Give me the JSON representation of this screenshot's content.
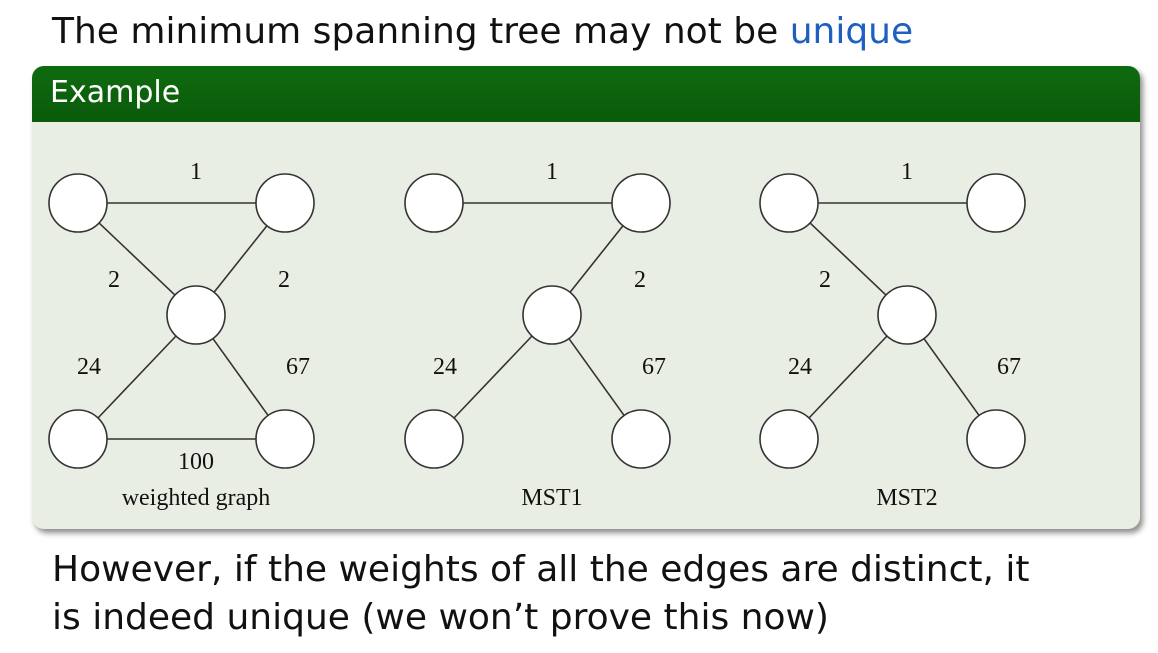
{
  "heading": {
    "text": "The minimum spanning tree may not be ",
    "emphasis": "unique"
  },
  "block": {
    "title": "Example"
  },
  "graphs": [
    {
      "caption": "weighted graph",
      "edges": [
        {
          "from": "top-left",
          "to": "top-right",
          "weight": "1"
        },
        {
          "from": "top-left",
          "to": "center",
          "weight": "2"
        },
        {
          "from": "top-right",
          "to": "center",
          "weight": "2"
        },
        {
          "from": "center",
          "to": "bottom-left",
          "weight": "24"
        },
        {
          "from": "center",
          "to": "bottom-right",
          "weight": "67"
        },
        {
          "from": "bottom-left",
          "to": "bottom-right",
          "weight": "100"
        }
      ]
    },
    {
      "caption": "MST1",
      "edges": [
        {
          "from": "top-left",
          "to": "top-right",
          "weight": "1"
        },
        {
          "from": "top-right",
          "to": "center",
          "weight": "2"
        },
        {
          "from": "center",
          "to": "bottom-left",
          "weight": "24"
        },
        {
          "from": "center",
          "to": "bottom-right",
          "weight": "67"
        }
      ]
    },
    {
      "caption": "MST2",
      "edges": [
        {
          "from": "top-left",
          "to": "top-right",
          "weight": "1"
        },
        {
          "from": "top-left",
          "to": "center",
          "weight": "2"
        },
        {
          "from": "center",
          "to": "bottom-left",
          "weight": "24"
        },
        {
          "from": "center",
          "to": "bottom-right",
          "weight": "67"
        }
      ]
    }
  ],
  "footer": {
    "line1": "However, if the weights of all the edges are distinct, it",
    "line2": "is indeed unique (we won’t prove this now)"
  }
}
